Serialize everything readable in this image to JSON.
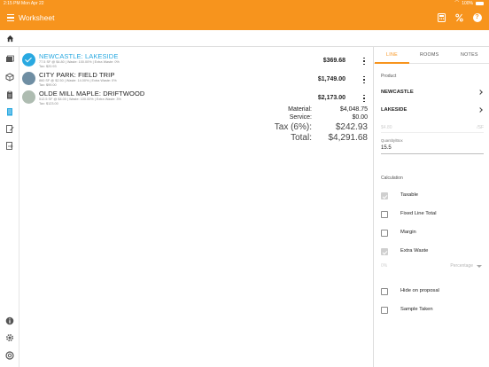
{
  "status_bar": {
    "time": "2:15 PM  Mon Apr 22",
    "battery": "100%"
  },
  "app_bar": {
    "title": "Worksheet"
  },
  "line_items": [
    {
      "name": "NEWCASTLE: LAKESIDE",
      "detail": "77.5 SF @ $4.80 | Waste: 100.00% | Extra Waste: 0%",
      "tax": "Tax: $20.93",
      "price": "$369.68",
      "selected": true,
      "avatar_color": "#29a9e1"
    },
    {
      "name": "CITY PARK: FIELD TRIP",
      "detail": "860 SF @ $2.50 | Waste: 14.00% | Extra Waste: 0%",
      "tax": "Tax: $99.00",
      "price": "$1,749.00",
      "selected": false,
      "avatar_color": "#6f8ea3"
    },
    {
      "name": "OLDE MILL MAPLE: DRIFTWOOD",
      "detail": "512.5 SF @ $4.00 | Waste: 100.00% | Extra Waste: 3%",
      "tax": "Tax: $123.00",
      "price": "$2,173.00",
      "selected": false,
      "avatar_color": "#aebcb1"
    }
  ],
  "totals": {
    "material_label": "Material:",
    "material_value": "$4,048.75",
    "service_label": "Service:",
    "service_value": "$0.00",
    "tax_label": "Tax (6%):",
    "tax_value": "$242.93",
    "total_label": "Total:",
    "total_value": "$4,291.68"
  },
  "panel": {
    "tabs": [
      "LINE",
      "ROOMS",
      "NOTES"
    ],
    "active_tab": "LINE",
    "product_label": "Product",
    "product_primary": "NEWCASTLE",
    "product_secondary": "LAKESIDE",
    "price_placeholder": "$4.80",
    "price_unit": "/SF",
    "quantity_label": "Quantity/Box",
    "quantity_value": "15.5",
    "calculation_label": "Calculation",
    "checks": [
      {
        "label": "Taxable",
        "checked": true,
        "disabled": true
      },
      {
        "label": "Fixed Line Total",
        "checked": false,
        "disabled": false
      },
      {
        "label": "Margin",
        "checked": false,
        "disabled": false
      },
      {
        "label": "Extra Waste",
        "checked": true,
        "disabled": true
      }
    ],
    "extra_waste_placeholder": "0%",
    "extra_waste_mode": "Percentage",
    "checks2": [
      {
        "label": "Hide on proposal",
        "checked": false
      },
      {
        "label": "Sample Taken",
        "checked": false
      }
    ]
  },
  "colors": {
    "accent": "#f7941d",
    "selected": "#29a9e1"
  }
}
